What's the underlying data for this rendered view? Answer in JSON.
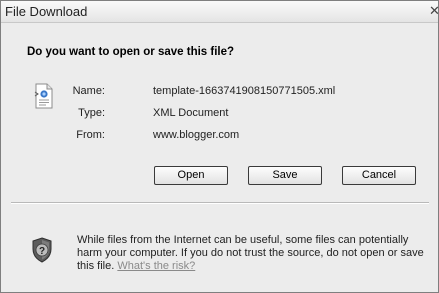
{
  "window": {
    "title": "File Download",
    "close_glyph": "✕"
  },
  "question": "Do you want to open or save this file?",
  "file": {
    "icon": "xml-document-icon",
    "name_label": "Name:",
    "name_value": "template-1663741908150771505.xml",
    "type_label": "Type:",
    "type_value": "XML Document",
    "from_label": "From:",
    "from_value": "www.blogger.com"
  },
  "buttons": {
    "open": "Open",
    "save": "Save",
    "cancel": "Cancel"
  },
  "warning": {
    "icon": "shield-question-icon",
    "text": "While files from the Internet can be useful, some files can potentially harm your computer. If you do not trust the source, do not open or save this file. ",
    "link": "What's the risk?"
  }
}
